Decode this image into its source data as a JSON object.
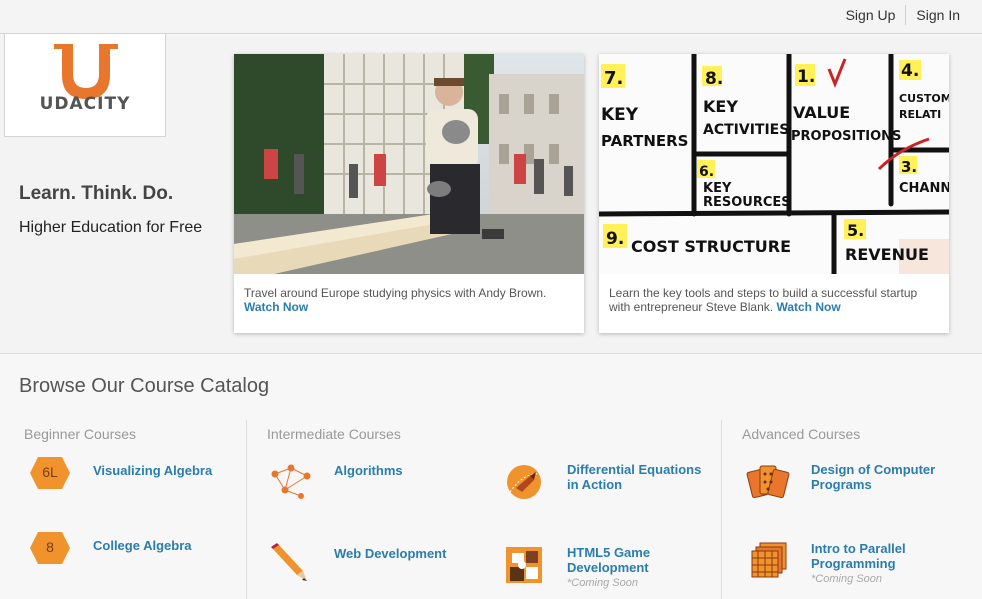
{
  "topnav": {
    "signup": "Sign Up",
    "signin": "Sign In"
  },
  "logo": {
    "letter": "U",
    "text": "UDACITY"
  },
  "hero": {
    "tagline": "Learn. Think. Do.",
    "subtag": "Higher Education for Free",
    "cards": [
      {
        "caption": "Travel around Europe studying physics with Andy Brown.",
        "watch": "Watch Now"
      },
      {
        "caption": "Learn the key tools and steps to build a successful startup with entrepreneur Steve Blank.",
        "watch": "Watch Now",
        "board": {
          "n7": "7.",
          "key_partners": "KEY PARTNERS",
          "n8": "8.",
          "key_activities": "KEY ACTIVITIES",
          "n1": "1.",
          "value_props": "VALUE PROPOSITIONS",
          "n4": "4.",
          "custom_rel": "CUSTOM RELATI",
          "n6": "6.",
          "key_resources": "KEY RESOURCES",
          "n3": "3.",
          "chann": "CHANN",
          "n9": "9.",
          "cost_structure": "COST STRUCTURE",
          "n5": "5.",
          "revenue": "REVENUE"
        }
      }
    ]
  },
  "catalog": {
    "title": "Browse Our Course Catalog",
    "columns": [
      {
        "label": "Beginner Courses"
      },
      {
        "label": "Intermediate Courses"
      },
      {
        "label": "Advanced Courses"
      }
    ],
    "courses": {
      "viz_algebra": {
        "title": "Visualizing Algebra",
        "badge": "6L"
      },
      "college_algebra": {
        "title": "College Algebra",
        "badge": "8"
      },
      "algorithms": {
        "title": "Algorithms"
      },
      "web_dev": {
        "title": "Web Development"
      },
      "diff_eq": {
        "title": "Differential Equations in Action"
      },
      "html5": {
        "title": "HTML5 Game Development",
        "note": "*Coming Soon"
      },
      "design_programs": {
        "title": "Design of Computer Programs"
      },
      "parallel": {
        "title": "Intro to Parallel Programming",
        "note": "*Coming Soon"
      }
    }
  },
  "colors": {
    "accent_orange": "#e8762d",
    "link_blue": "#2a7dad"
  }
}
